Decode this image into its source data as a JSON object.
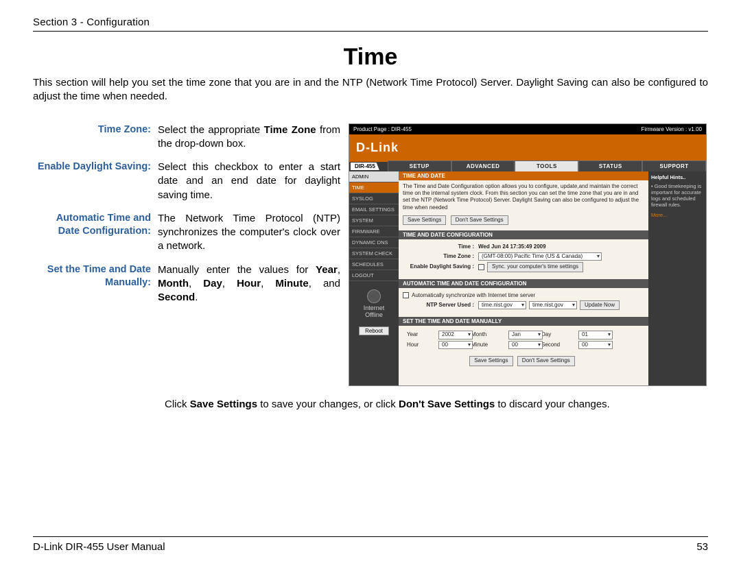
{
  "header": {
    "section": "Section 3 - Configuration"
  },
  "title": "Time",
  "intro": "This section will help you set the time zone that you are in and the NTP (Network Time Protocol) Server. Daylight Saving can also be configured to adjust the time when needed.",
  "defs": {
    "tz_label": "Time Zone:",
    "tz_text_a": "Select the appropriate ",
    "tz_text_b": "Time Zone",
    "tz_text_c": " from the drop-down box.",
    "eds_label": "Enable Daylight Saving:",
    "eds_text": "Select this checkbox to enter a start date and an end date for daylight saving time.",
    "auto_label": "Automatic Time and Date Configuration:",
    "auto_text": "The Network Time Protocol (NTP) synchronizes the computer's clock over a network.",
    "man_label": "Set the Time and Date Manually:",
    "man_a": "Manually enter the values for ",
    "man_b": "Year",
    "man_c": ", ",
    "man_d": "Month",
    "man_e": ", ",
    "man_f": "Day",
    "man_g": ", ",
    "man_h": "Hour",
    "man_i": ", ",
    "man_j": "Minute",
    "man_k": ", and ",
    "man_l": "Second",
    "man_m": "."
  },
  "bottom_note": {
    "a": "Click ",
    "b": "Save Settings",
    "c": " to save your changes, or click ",
    "d": "Don't Save Settings",
    "e": " to discard your changes."
  },
  "router": {
    "product_page": "Product Page : DIR-455",
    "firmware": "Firmware Version : v1.00",
    "brand": "D-Link",
    "model": "DIR-455",
    "tabs": {
      "setup": "SETUP",
      "advanced": "ADVANCED",
      "tools": "TOOLS",
      "status": "STATUS",
      "support": "SUPPORT"
    },
    "side": [
      "ADMIN",
      "TIME",
      "SYSLOG",
      "EMAIL SETTINGS",
      "SYSTEM",
      "FIRMWARE",
      "DYNAMIC DNS",
      "SYSTEM CHECK",
      "SCHEDULES",
      "LOGOUT"
    ],
    "panel_title": "TIME AND DATE",
    "panel_text": "The Time and Date Configuration option allows you to configure, update,and maintain the correct time on the internal system clock. From this section you can set the time zone that you are in and set the NTP (Network Time Protocol) Server. Daylight Saving can also be configured to adjust the time when needed",
    "save": "Save Settings",
    "dontsave": "Don't Save Settings",
    "cfg_title": "TIME AND DATE CONFIGURATION",
    "time_label": "Time :",
    "time_value": "Wed Jun 24 17:35:49 2009",
    "tz_label": "Time Zone :",
    "tz_value": "(GMT-08:00) Pacific Time (US & Canada)",
    "eds_label": "Enable Daylight Saving :",
    "sync_btn": "Sync. your computer's time settings",
    "auto_title": "AUTOMATIC TIME AND DATE CONFIGURATION",
    "auto_chk_label": "Automatically synchronize with Internet time server",
    "ntp_label": "NTP Server Used :",
    "ntp_text": "time.nist.gov",
    "ntp_sel": "time.nist.gov",
    "update_now": "Update Now",
    "man_title": "SET THE TIME AND DATE MANUALLY",
    "year_l": "Year",
    "year_v": "2002",
    "month_l": "Month",
    "month_v": "Jan",
    "day_l": "Day",
    "day_v": "01",
    "hour_l": "Hour",
    "hour_v": "00",
    "minute_l": "Minute",
    "minute_v": "00",
    "second_l": "Second",
    "second_v": "00",
    "help_title": "Helpful Hints..",
    "help_text": "• Good timekeeping is important for accurate logs and scheduled firewall rules.",
    "help_more": "More...",
    "internet": "Internet",
    "offline": "Offline",
    "reboot": "Reboot"
  },
  "footer": {
    "left": "D-Link DIR-455 User Manual",
    "right": "53"
  }
}
